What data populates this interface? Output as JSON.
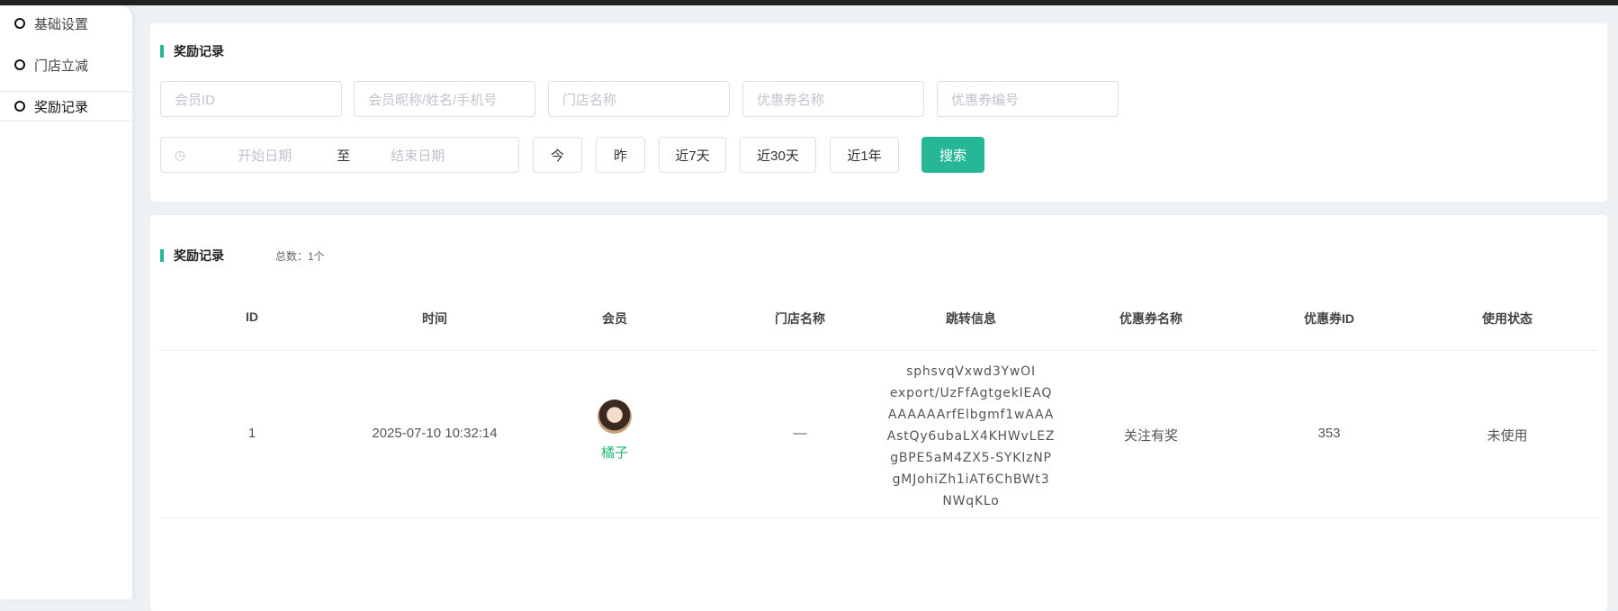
{
  "sidebar": {
    "items": [
      {
        "label": "基础设置"
      },
      {
        "label": "门店立减"
      },
      {
        "label": "奖励记录"
      }
    ]
  },
  "filter": {
    "title": "奖励记录",
    "placeholders": {
      "member_id": "会员ID",
      "member_info": "会员昵称/姓名/手机号",
      "store_name": "门店名称",
      "coupon_name": "优惠券名称",
      "coupon_no": "优惠券编号",
      "start_date": "开始日期",
      "end_date": "结束日期"
    },
    "range_sep": "至",
    "quick": [
      "今",
      "昨",
      "近7天",
      "近30天",
      "近1年"
    ],
    "search_label": "搜索"
  },
  "records": {
    "title": "奖励记录",
    "total": "总数：1个",
    "columns": [
      "ID",
      "时间",
      "会员",
      "门店名称",
      "跳转信息",
      "优惠券名称",
      "优惠券ID",
      "使用状态"
    ],
    "rows": [
      {
        "id": "1",
        "time": "2025-07-10 10:32:14",
        "member": "橘子",
        "store": "—",
        "jump": [
          "sphsvqVxwd3YwOI",
          "export/UzFfAgtgekIEAQ",
          "AAAAAArfElbgmf1wAAA",
          "AstQy6ubaLX4KHWvLEZ",
          "gBPE5aM4ZX5-SYKIzNP",
          "gMJohiZh1iAT6ChBWt3",
          "NWqKLo"
        ],
        "coupon_name": "关注有奖",
        "coupon_id": "353",
        "status": "未使用"
      }
    ]
  },
  "colors": {
    "accent": "#26b896",
    "member_name": "#1fb86e"
  }
}
